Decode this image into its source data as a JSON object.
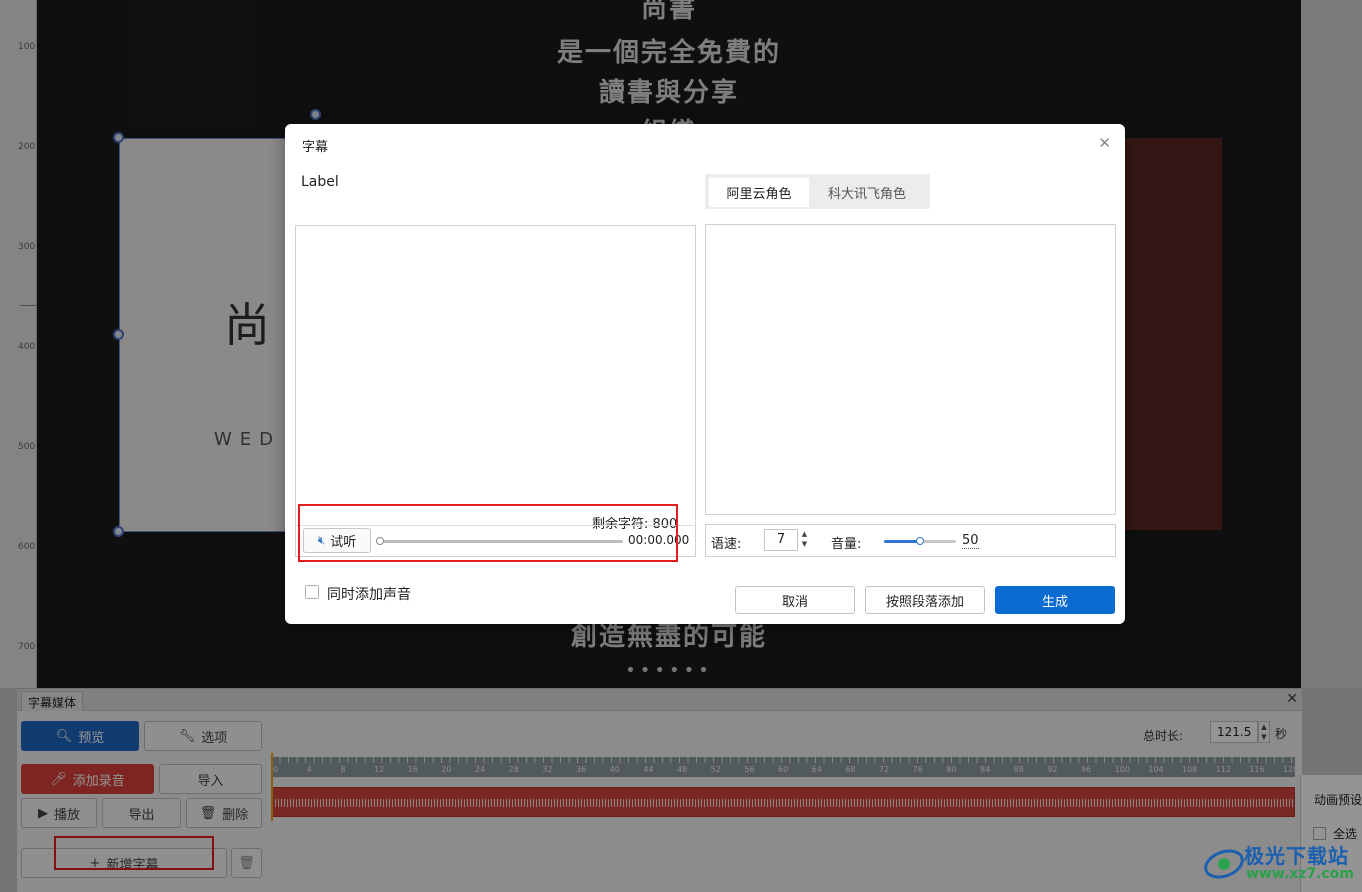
{
  "ruler": {
    "ticks": [
      "100",
      "200",
      "300",
      "400",
      "500",
      "600",
      "700"
    ]
  },
  "slide": {
    "line_top": "尚書",
    "line1": "是一個完全免費的",
    "line2": "讀書與分享",
    "line3": "組織",
    "line_bottom": "創造無盡的可能",
    "dots": "••••••",
    "logo_char": "尚",
    "logo_sub": "WED"
  },
  "modal": {
    "title": "字幕",
    "label": "Label",
    "tabs": [
      "阿里云角色",
      "科大讯飞角色"
    ],
    "remaining": "剩余字符: 800",
    "listen": "试听",
    "time": "00:00.000",
    "speed_label": "语速:",
    "speed_value": "7",
    "volume_label": "音量:",
    "volume_value": "50",
    "volume_level": 0.5,
    "add_audio": "同时添加声音",
    "buttons": {
      "cancel": "取消",
      "by_paragraph": "按照段落添加",
      "generate": "生成"
    }
  },
  "panel": {
    "tab": "字幕媒体",
    "preview": "预览",
    "options": "选项",
    "add_recording": "添加录音",
    "import": "导入",
    "play": "播放",
    "export": "导出",
    "delete": "删除",
    "new_subtitle": "新增字幕",
    "total_label": "总时长:",
    "total_value": "121.5",
    "seconds": "秒",
    "timeline_marks": [
      "0",
      "4",
      "8",
      "12",
      "16",
      "20",
      "24",
      "28",
      "32",
      "36",
      "40",
      "44",
      "48",
      "52",
      "56",
      "60",
      "64",
      "68",
      "72",
      "76",
      "80",
      "84",
      "88",
      "92",
      "96",
      "100",
      "104",
      "108",
      "112",
      "116",
      "120"
    ]
  },
  "side": {
    "title": "动画预设",
    "select_all": "全选"
  },
  "watermark": {
    "name": "极光下载站",
    "url": "www.xz7.com"
  },
  "colors": {
    "accent": "#0a6bd1",
    "danger": "#d9413a",
    "highlight": "#e02020"
  }
}
